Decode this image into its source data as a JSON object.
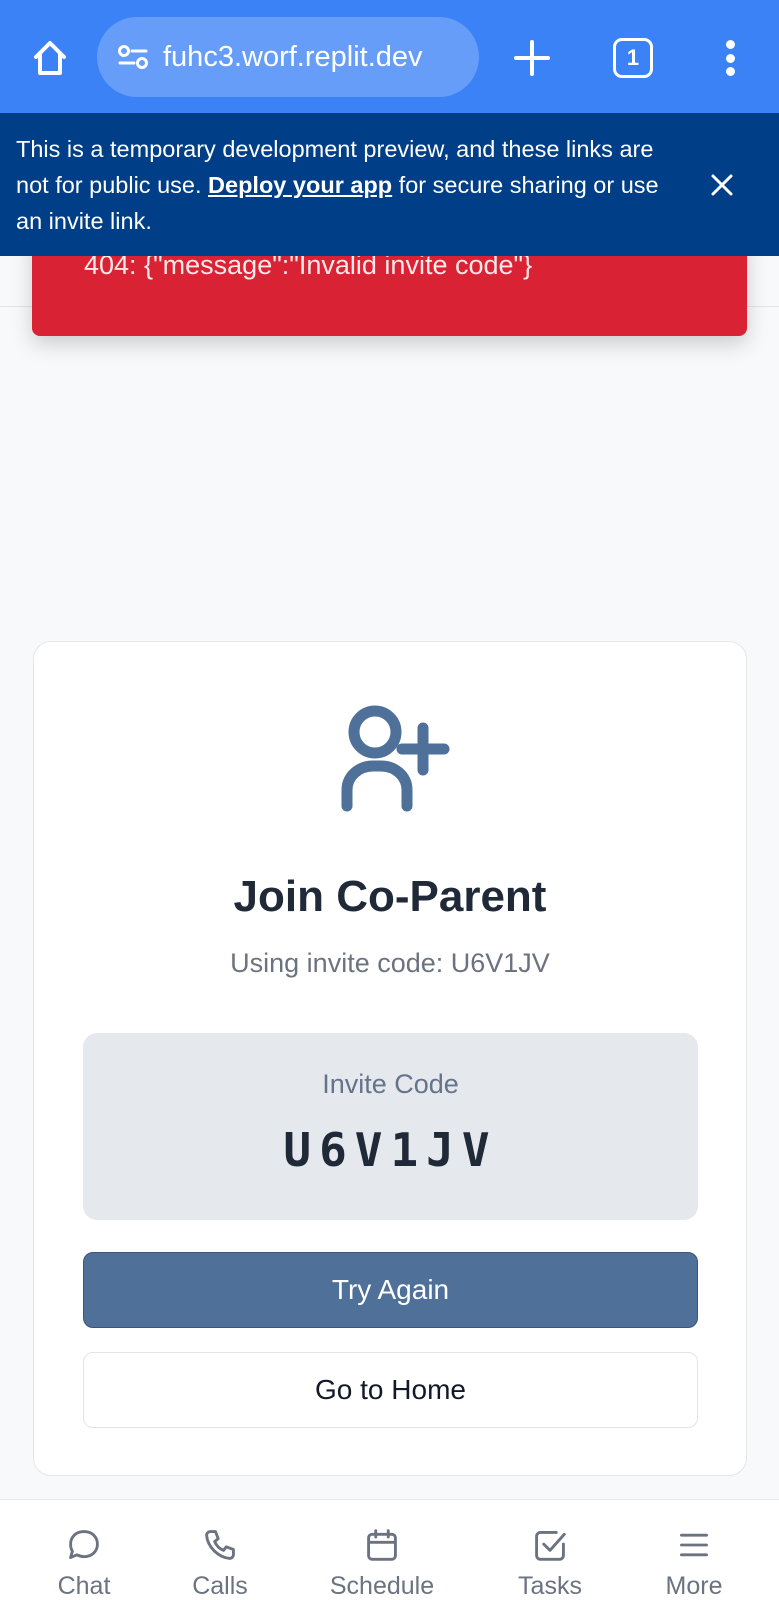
{
  "browser": {
    "url": "fuhc3.worf.replit.dev",
    "tab_count": "1"
  },
  "banner": {
    "text_before": "This is a temporary development preview, and these links are not for public use. ",
    "link_text": "Deploy your app",
    "text_after": " for secure sharing or use an invite link."
  },
  "error_toast": {
    "message": "404: {\"message\":\"Invalid invite code\"}"
  },
  "card": {
    "title": "Join Co-Parent",
    "subtitle": "Using invite code: U6V1JV",
    "code_label": "Invite Code",
    "code_value": "U6V1JV",
    "primary_button": "Try Again",
    "secondary_button": "Go to Home"
  },
  "bottom_nav": {
    "items": [
      {
        "label": "Chat",
        "icon": "chat-bubble-icon"
      },
      {
        "label": "Calls",
        "icon": "phone-icon"
      },
      {
        "label": "Schedule",
        "icon": "calendar-icon"
      },
      {
        "label": "Tasks",
        "icon": "checkbox-icon"
      },
      {
        "label": "More",
        "icon": "hamburger-menu-icon"
      }
    ]
  },
  "colors": {
    "browser_bar": "#3b82f6",
    "banner": "#003f87",
    "error": "#d92234",
    "accent": "#4e7099"
  }
}
